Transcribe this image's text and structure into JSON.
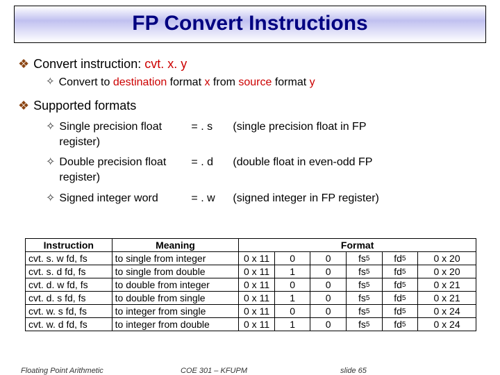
{
  "title": "FP Convert Instructions",
  "line1_a": "Convert instruction: ",
  "line1_b_pre": "cvt",
  "line1_b_mid1": ". ",
  "line1_b_x": "x",
  "line1_b_mid2": ". ",
  "line1_b_y": "y",
  "line1_sub_a": "Convert to ",
  "line1_sub_b": "destination",
  "line1_sub_c": " format ",
  "line1_sub_d": "x",
  "line1_sub_e": " from ",
  "line1_sub_f": "source",
  "line1_sub_g": " format ",
  "line1_sub_h": "y",
  "line2": "Supported formats",
  "fmt": [
    {
      "a": "Single precision float",
      "reg": "register)",
      "b": "= . s",
      "c": "(single precision float in FP"
    },
    {
      "a": "Double precision float",
      "reg": "register)",
      "b": "= . d",
      "c": "(double float in even-odd FP"
    },
    {
      "a": "Signed integer word",
      "reg": "",
      "b": "= . w",
      "c": "(signed integer in FP register)"
    }
  ],
  "th": {
    "instr": "Instruction",
    "mean": "Meaning",
    "format": "Format"
  },
  "rows": [
    {
      "op": "cvt. s. w  fd, fs",
      "me": "to single from integer",
      "f1": "0 x 11",
      "f2": "0",
      "f3": "0",
      "f4": "fs",
      "f4s": "5",
      "f5": "fd",
      "f5s": "5",
      "f6": "0 x 20"
    },
    {
      "op": "cvt. s. d  fd, fs",
      "me": "to single from double",
      "f1": "0 x 11",
      "f2": "1",
      "f3": "0",
      "f4": "fs",
      "f4s": "5",
      "f5": "fd",
      "f5s": "5",
      "f6": "0 x 20"
    },
    {
      "op": "cvt. d. w  fd, fs",
      "me": "to double from integer",
      "f1": "0 x 11",
      "f2": "0",
      "f3": "0",
      "f4": "fs",
      "f4s": "5",
      "f5": "fd",
      "f5s": "5",
      "f6": "0 x 21"
    },
    {
      "op": "cvt. d. s  fd, fs",
      "me": "to double from single",
      "f1": "0 x 11",
      "f2": "1",
      "f3": "0",
      "f4": "fs",
      "f4s": "5",
      "f5": "fd",
      "f5s": "5",
      "f6": "0 x 21"
    },
    {
      "op": "cvt. w. s  fd, fs",
      "me": "to integer from single",
      "f1": "0 x 11",
      "f2": "0",
      "f3": "0",
      "f4": "fs",
      "f4s": "5",
      "f5": "fd",
      "f5s": "5",
      "f6": "0 x 24"
    },
    {
      "op": "cvt. w. d  fd, fs",
      "me": "to integer from double",
      "f1": "0 x 11",
      "f2": "1",
      "f3": "0",
      "f4": "fs",
      "f4s": "5",
      "f5": "fd",
      "f5s": "5",
      "f6": "0 x 24"
    }
  ],
  "footer": {
    "a": "Floating Point Arithmetic",
    "b": "COE 301 – KFUPM",
    "c": "slide 65"
  },
  "chart_data": {
    "type": "table",
    "title": "FP Convert Instructions",
    "columns": [
      "Instruction",
      "Meaning",
      "Format[0]",
      "Format[1]",
      "Format[2]",
      "Format[3]",
      "Format[4]",
      "Format[5]"
    ],
    "rows": [
      [
        "cvt.s.w fd, fs",
        "to single from integer",
        "0x11",
        "0",
        "0",
        "fs5",
        "fd5",
        "0x20"
      ],
      [
        "cvt.s.d fd, fs",
        "to single from double",
        "0x11",
        "1",
        "0",
        "fs5",
        "fd5",
        "0x20"
      ],
      [
        "cvt.d.w fd, fs",
        "to double from integer",
        "0x11",
        "0",
        "0",
        "fs5",
        "fd5",
        "0x21"
      ],
      [
        "cvt.d.s fd, fs",
        "to double from single",
        "0x11",
        "1",
        "0",
        "fs5",
        "fd5",
        "0x21"
      ],
      [
        "cvt.w.s fd, fs",
        "to integer from single",
        "0x11",
        "0",
        "0",
        "fs5",
        "fd5",
        "0x24"
      ],
      [
        "cvt.w.d fd, fs",
        "to integer from double",
        "0x11",
        "1",
        "0",
        "fs5",
        "fd5",
        "0x24"
      ]
    ]
  }
}
